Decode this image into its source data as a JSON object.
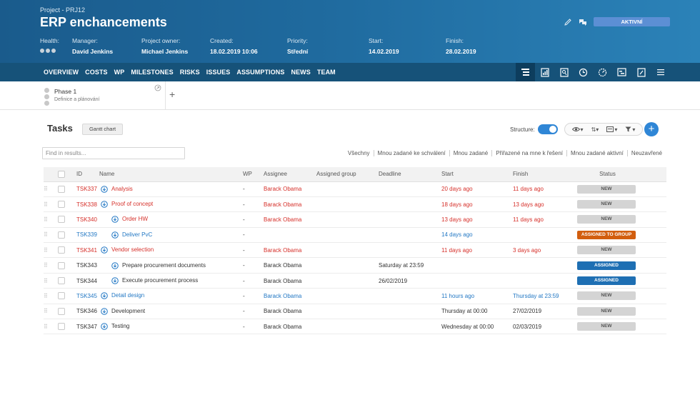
{
  "header": {
    "breadcrumb": "Project - PRJ12",
    "title": "ERP enchancements",
    "status": "AKTIVNÍ",
    "meta": {
      "health_label": "Health:",
      "manager_label": "Manager:",
      "manager": "David Jenkins",
      "owner_label": "Project owner:",
      "owner": "Michael Jenkins",
      "created_label": "Created:",
      "created": "18.02.2019 10:06",
      "priority_label": "Priority:",
      "priority": "Střední",
      "start_label": "Start:",
      "start": "14.02.2019",
      "finish_label": "Finish:",
      "finish": "28.02.2019"
    }
  },
  "nav": {
    "tabs": [
      "OVERVIEW",
      "COSTS",
      "WP",
      "MILESTONES",
      "RISKS",
      "ISSUES",
      "ASSUMPTIONS",
      "NEWS",
      "TEAM"
    ],
    "icons": [
      "tasks-icon",
      "report-icon",
      "document-search-icon",
      "history-icon",
      "dashboard-icon",
      "timeline-icon",
      "attachment-icon",
      "menu-icon"
    ]
  },
  "phase": {
    "name": "Phase 1",
    "subtitle": "Definice a plánování",
    "add_label": "+"
  },
  "tasks": {
    "title": "Tasks",
    "gantt_label": "Gantt chart",
    "structure_label": "Structure:",
    "search_placeholder": "Find in results...",
    "filters": [
      "Všechny",
      "Mnou zadané ke schválení",
      "Mnou zadané",
      "Přiřazené na mne k řešení",
      "Mnou zadané aktivní",
      "Neuzavřené"
    ],
    "columns": {
      "id": "ID",
      "name": "Name",
      "wp": "WP",
      "assignee": "Assignee",
      "group": "Assigned group",
      "deadline": "Deadline",
      "start": "Start",
      "finish": "Finish",
      "status": "Status"
    },
    "rows": [
      {
        "id": "TSK337",
        "name": "Analysis",
        "indent": 0,
        "wp": "-",
        "assignee": "Barack Obama",
        "group": "",
        "deadline": "",
        "start": "20 days ago",
        "finish": "11 days ago",
        "status": "NEW",
        "color": "red"
      },
      {
        "id": "TSK338",
        "name": "Proof of concept",
        "indent": 0,
        "wp": "-",
        "assignee": "Barack Obama",
        "group": "",
        "deadline": "",
        "start": "18 days ago",
        "finish": "13 days ago",
        "status": "NEW",
        "color": "red"
      },
      {
        "id": "TSK340",
        "name": "Order HW",
        "indent": 1,
        "wp": "-",
        "assignee": "Barack Obama",
        "group": "",
        "deadline": "",
        "start": "13 days ago",
        "finish": "11 days ago",
        "status": "NEW",
        "color": "red"
      },
      {
        "id": "TSK339",
        "name": "Deliver PvC",
        "indent": 1,
        "wp": "-",
        "assignee": "",
        "group": "",
        "deadline": "",
        "start": "14 days ago",
        "finish": "",
        "status": "ASSIGNED TO GROUP",
        "color": "blue"
      },
      {
        "id": "TSK341",
        "name": "Vendor selection",
        "indent": 0,
        "wp": "-",
        "assignee": "Barack Obama",
        "group": "",
        "deadline": "",
        "start": "11 days ago",
        "finish": "3 days ago",
        "status": "NEW",
        "color": "red"
      },
      {
        "id": "TSK343",
        "name": "Prepare procurement documents",
        "indent": 1,
        "wp": "-",
        "assignee": "Barack Obama",
        "group": "",
        "deadline": "Saturday at 23:59",
        "start": "",
        "finish": "",
        "status": "ASSIGNED",
        "color": "dark"
      },
      {
        "id": "TSK344",
        "name": "Execute procurement process",
        "indent": 1,
        "wp": "-",
        "assignee": "Barack Obama",
        "group": "",
        "deadline": "26/02/2019",
        "start": "",
        "finish": "",
        "status": "ASSIGNED",
        "color": "dark"
      },
      {
        "id": "TSK345",
        "name": "Detail design",
        "indent": 0,
        "wp": "-",
        "assignee": "Barack Obama",
        "group": "",
        "deadline": "",
        "start": "11 hours ago",
        "finish": "Thursday at 23:59",
        "status": "NEW",
        "color": "blue"
      },
      {
        "id": "TSK346",
        "name": "Development",
        "indent": 0,
        "wp": "-",
        "assignee": "Barack Obama",
        "group": "",
        "deadline": "",
        "start": "Thursday at 00:00",
        "finish": "27/02/2019",
        "status": "NEW",
        "color": "dark"
      },
      {
        "id": "TSK347",
        "name": "Testing",
        "indent": 0,
        "wp": "-",
        "assignee": "Barack Obama",
        "group": "",
        "deadline": "",
        "start": "Wednesday at 00:00",
        "finish": "02/03/2019",
        "status": "NEW",
        "color": "dark"
      }
    ]
  },
  "colors": {
    "header": "#1f6a9e",
    "nav": "#165279",
    "accent": "#2f86d6",
    "overdue": "#d6302a",
    "group_badge": "#d25e0f",
    "assigned_badge": "#1e6fb3"
  }
}
